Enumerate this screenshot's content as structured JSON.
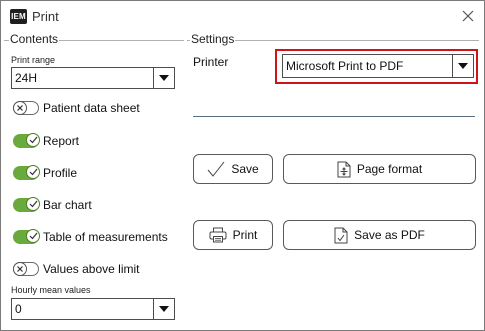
{
  "window": {
    "title": "Print",
    "app_badge": "IEM"
  },
  "contents": {
    "group_label": "Contents",
    "print_range": {
      "label": "Print range",
      "value": "24H"
    },
    "options": [
      {
        "label": "Patient data sheet",
        "checked": false
      },
      {
        "label": "Report",
        "checked": true
      },
      {
        "label": "Profile",
        "checked": true
      },
      {
        "label": "Bar chart",
        "checked": true
      },
      {
        "label": "Table of measurements",
        "checked": true
      },
      {
        "label": "Values above limit",
        "checked": false
      }
    ],
    "hourly_mean": {
      "label": "Hourly mean values",
      "value": "0"
    }
  },
  "settings": {
    "group_label": "Settings",
    "printer_label": "Printer",
    "printer_value": "Microsoft Print to PDF",
    "buttons": {
      "save": "Save",
      "page_format": "Page format",
      "print": "Print",
      "save_as_pdf": "Save as PDF"
    }
  },
  "colors": {
    "toggle_on": "#6aa93c",
    "highlight": "#d0131a"
  }
}
